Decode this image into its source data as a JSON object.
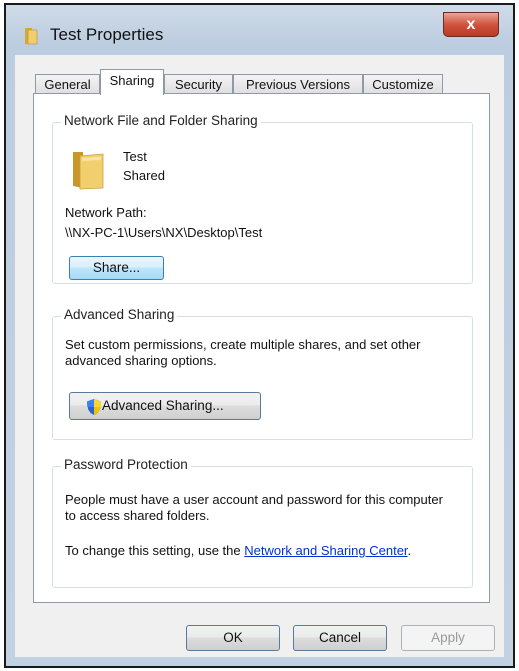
{
  "window": {
    "title": "Test Properties",
    "close_label": "x"
  },
  "tabs": [
    {
      "label": "General"
    },
    {
      "label": "Sharing"
    },
    {
      "label": "Security"
    },
    {
      "label": "Previous Versions"
    },
    {
      "label": "Customize"
    }
  ],
  "active_tab": "Sharing",
  "network_sharing": {
    "group_title": "Network File and Folder Sharing",
    "folder_name": "Test",
    "folder_state": "Shared",
    "path_label": "Network Path:",
    "path_value": "\\\\NX-PC-1\\Users\\NX\\Desktop\\Test",
    "share_button": "Share..."
  },
  "advanced_sharing": {
    "group_title": "Advanced Sharing",
    "description": "Set custom permissions, create multiple shares, and set other advanced sharing options.",
    "button": "Advanced Sharing..."
  },
  "password_protection": {
    "group_title": "Password Protection",
    "description": "People must have a user account and password for this computer to access shared folders.",
    "change_prefix": "To change this setting, use the ",
    "link_text": "Network and Sharing Center",
    "change_suffix": "."
  },
  "buttons": {
    "ok": "OK",
    "cancel": "Cancel",
    "apply": "Apply"
  },
  "colors": {
    "folder": "#e8c060",
    "link": "#0033cc",
    "close": "#c94a35"
  },
  "icons": {
    "title": "folder-icon",
    "folder": "folder-icon",
    "shield": "uac-shield-icon"
  }
}
